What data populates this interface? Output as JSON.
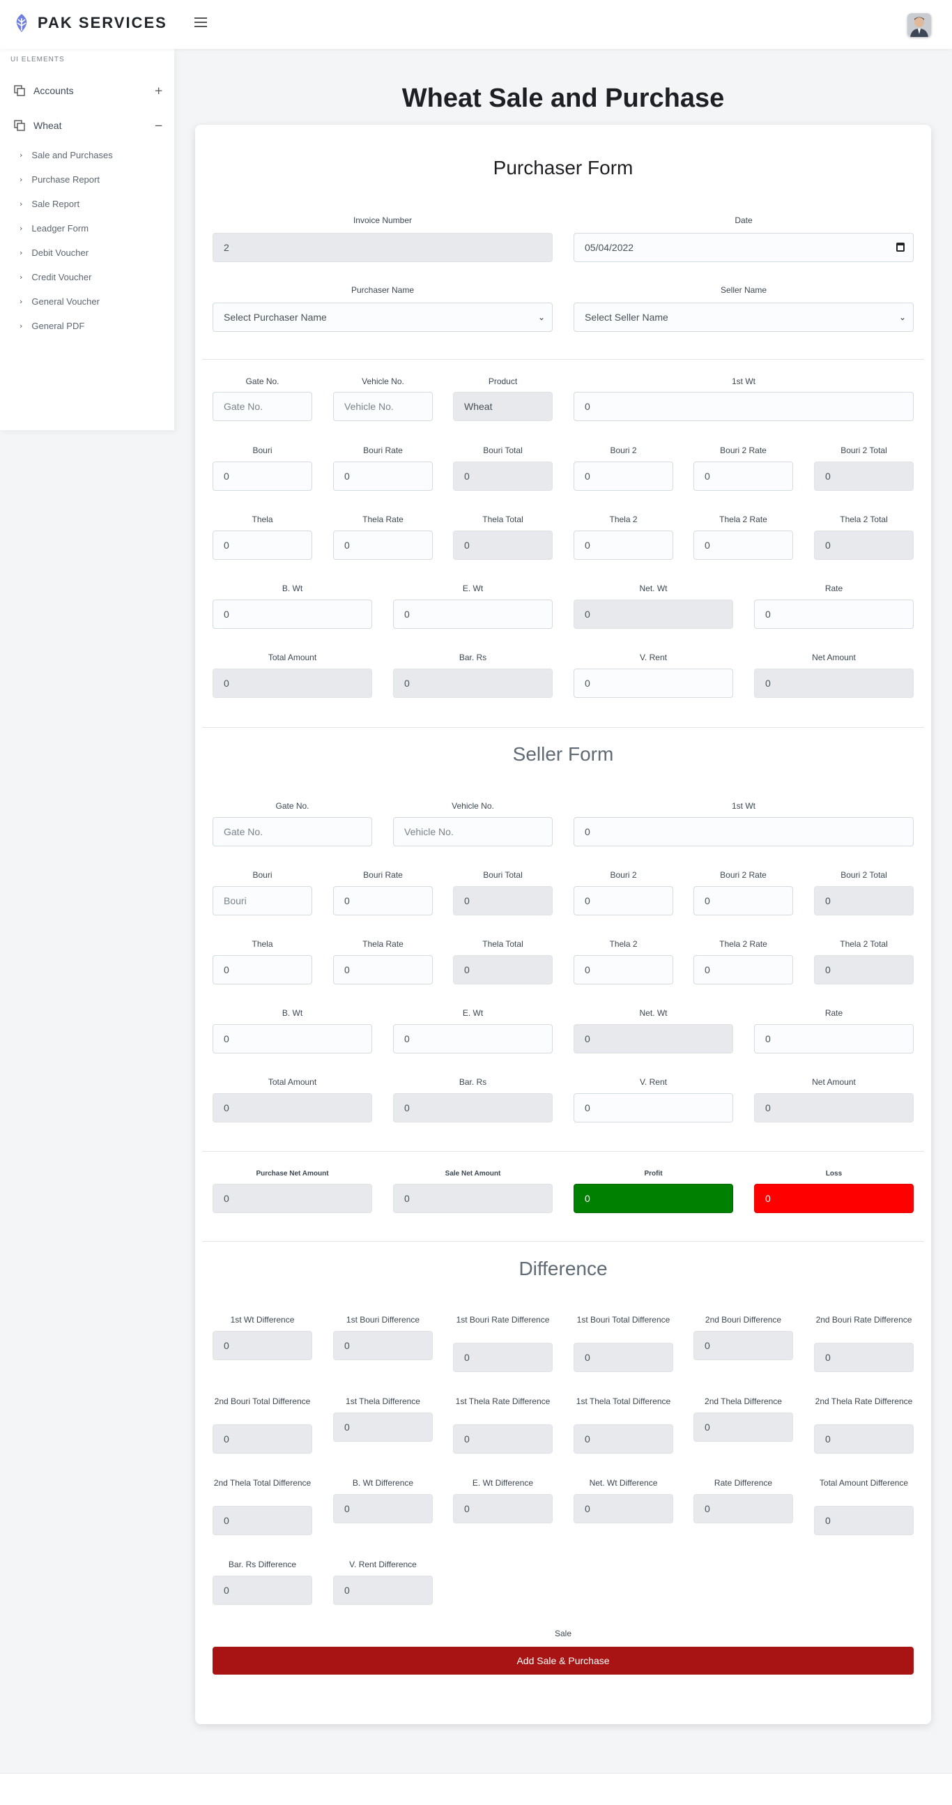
{
  "brand": {
    "name": "PAK SERVICES"
  },
  "sidebar": {
    "heading": "UI ELEMENTS",
    "menus": [
      {
        "label": "Accounts",
        "toggle": "+"
      },
      {
        "label": "Wheat",
        "toggle": "−"
      }
    ],
    "sub_items": [
      "Sale and Purchases",
      "Purchase Report",
      "Sale Report",
      "Leadger Form",
      "Debit Voucher",
      "Credit Voucher",
      "General Voucher",
      "General PDF"
    ]
  },
  "page": {
    "title": "Wheat Sale and Purchase"
  },
  "purchaser": {
    "title": "Purchaser Form",
    "invoice_label": "Invoice Number",
    "invoice_value": "2",
    "date_label": "Date",
    "date_value": "05/04/2022",
    "purchaser_name_label": "Purchaser Name",
    "purchaser_name_value": "Select Purchaser Name",
    "seller_name_label": "Seller Name",
    "seller_name_value": "Select Seller Name",
    "gate_label": "Gate No.",
    "gate_placeholder": "Gate No.",
    "vehicle_label": "Vehicle No.",
    "vehicle_placeholder": "Vehicle No.",
    "product_label": "Product",
    "product_value": "Wheat",
    "wt1_label": "1st Wt",
    "wt1_value": "0",
    "bouri_label": "Bouri",
    "bouri_value": "0",
    "bouri_rate_label": "Bouri Rate",
    "bouri_rate_value": "0",
    "bouri_total_label": "Bouri Total",
    "bouri_total_value": "0",
    "bouri2_label": "Bouri 2",
    "bouri2_value": "0",
    "bouri2_rate_label": "Bouri 2 Rate",
    "bouri2_rate_value": "0",
    "bouri2_total_label": "Bouri 2 Total",
    "bouri2_total_value": "0",
    "thela_label": "Thela",
    "thela_value": "0",
    "thela_rate_label": "Thela Rate",
    "thela_rate_value": "0",
    "thela_total_label": "Thela Total",
    "thela_total_value": "0",
    "thela2_label": "Thela 2",
    "thela2_value": "0",
    "thela2_rate_label": "Thela 2 Rate",
    "thela2_rate_value": "0",
    "thela2_total_label": "Thela 2 Total",
    "thela2_total_value": "0",
    "bwt_label": "B. Wt",
    "bwt_value": "0",
    "ewt_label": "E. Wt",
    "ewt_value": "0",
    "netwt_label": "Net. Wt",
    "netwt_value": "0",
    "rate_label": "Rate",
    "rate_value": "0",
    "total_amount_label": "Total Amount",
    "total_amount_value": "0",
    "bar_rs_label": "Bar. Rs",
    "bar_rs_value": "0",
    "v_rent_label": "V. Rent",
    "v_rent_value": "0",
    "net_amount_label": "Net Amount",
    "net_amount_value": "0"
  },
  "seller": {
    "title": "Seller Form",
    "gate_label": "Gate No.",
    "gate_placeholder": "Gate No.",
    "vehicle_label": "Vehicle No.",
    "vehicle_placeholder": "Vehicle No.",
    "wt1_label": "1st Wt",
    "wt1_value": "0",
    "bouri_label": "Bouri",
    "bouri_placeholder": "Bouri",
    "bouri_rate_label": "Bouri Rate",
    "bouri_rate_value": "0",
    "bouri_total_label": "Bouri Total",
    "bouri_total_value": "0",
    "bouri2_label": "Bouri 2",
    "bouri2_value": "0",
    "bouri2_rate_label": "Bouri 2 Rate",
    "bouri2_rate_value": "0",
    "bouri2_total_label": "Bouri 2 Total",
    "bouri2_total_value": "0",
    "thela_label": "Thela",
    "thela_value": "0",
    "thela_rate_label": "Thela Rate",
    "thela_rate_value": "0",
    "thela_total_label": "Thela Total",
    "thela_total_value": "0",
    "thela2_label": "Thela 2",
    "thela2_value": "0",
    "thela2_rate_label": "Thela 2 Rate",
    "thela2_rate_value": "0",
    "thela2_total_label": "Thela 2 Total",
    "thela2_total_value": "0",
    "bwt_label": "B. Wt",
    "bwt_value": "0",
    "ewt_label": "E. Wt",
    "ewt_value": "0",
    "netwt_label": "Net. Wt",
    "netwt_value": "0",
    "rate_label": "Rate",
    "rate_value": "0",
    "total_amount_label": "Total Amount",
    "total_amount_value": "0",
    "bar_rs_label": "Bar. Rs",
    "bar_rs_value": "0",
    "v_rent_label": "V. Rent",
    "v_rent_value": "0",
    "net_amount_label": "Net Amount",
    "net_amount_value": "0"
  },
  "summary": {
    "purchase_net_label": "Purchase Net Amount",
    "purchase_net_value": "0",
    "sale_net_label": "Sale Net Amount",
    "sale_net_value": "0",
    "profit_label": "Profit",
    "profit_value": "0",
    "loss_label": "Loss",
    "loss_value": "0",
    "profit_color": "#008000",
    "loss_color": "#ff0000"
  },
  "difference": {
    "title": "Difference",
    "items": [
      {
        "label": "1st Wt Difference",
        "value": "0"
      },
      {
        "label": "1st Bouri Difference",
        "value": "0"
      },
      {
        "label": "1st Bouri Rate Difference",
        "value": "0"
      },
      {
        "label": "1st Bouri Total Difference",
        "value": "0"
      },
      {
        "label": "2nd Bouri Difference",
        "value": "0"
      },
      {
        "label": "2nd Bouri Rate Difference",
        "value": "0"
      },
      {
        "label": "2nd Bouri Total Difference",
        "value": "0"
      },
      {
        "label": "1st Thela Difference",
        "value": "0"
      },
      {
        "label": "1st Thela Rate Difference",
        "value": "0"
      },
      {
        "label": "1st Thela Total Difference",
        "value": "0"
      },
      {
        "label": "2nd Thela Difference",
        "value": "0"
      },
      {
        "label": "2nd Thela Rate Difference",
        "value": "0"
      },
      {
        "label": "2nd Thela Total Difference",
        "value": "0"
      },
      {
        "label": "B. Wt Difference",
        "value": "0"
      },
      {
        "label": "E. Wt Difference",
        "value": "0"
      },
      {
        "label": "Net. Wt Difference",
        "value": "0"
      },
      {
        "label": "Rate Difference",
        "value": "0"
      },
      {
        "label": "Total Amount Difference",
        "value": "0"
      },
      {
        "label": "Bar. Rs Difference",
        "value": "0"
      },
      {
        "label": "V. Rent Difference",
        "value": "0"
      }
    ]
  },
  "submit": {
    "label": "Sale",
    "button": "Add Sale & Purchase",
    "color": "#a81414"
  }
}
